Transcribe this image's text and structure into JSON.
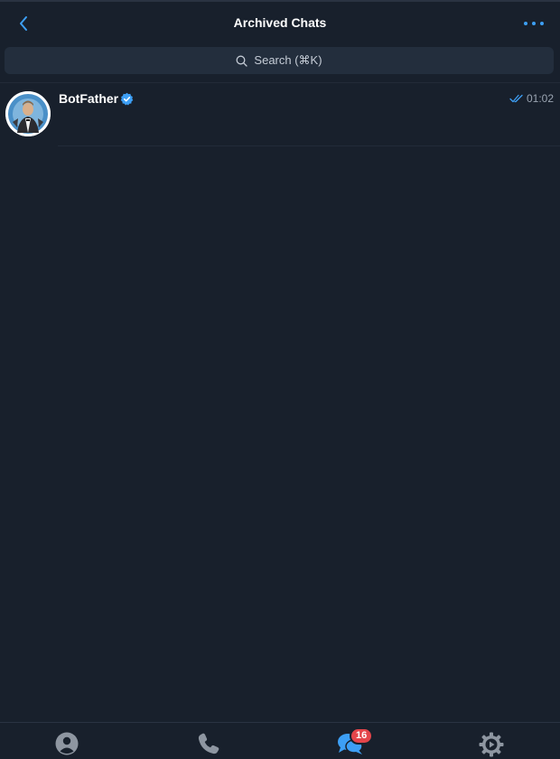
{
  "header": {
    "title": "Archived Chats",
    "back_icon": "chevron-left-icon",
    "more_icon": "ellipsis-icon"
  },
  "search": {
    "placeholder": "Search (⌘K)",
    "icon": "search-icon"
  },
  "chats": [
    {
      "name": "BotFather",
      "verified": true,
      "time": "01:02",
      "status": "read"
    }
  ],
  "tabbar": {
    "tabs": [
      {
        "id": "contacts",
        "icon": "person-icon"
      },
      {
        "id": "calls",
        "icon": "phone-icon"
      },
      {
        "id": "chats",
        "icon": "chat-bubbles-icon",
        "badge": "16",
        "active": true
      },
      {
        "id": "settings",
        "icon": "gear-icon"
      }
    ]
  },
  "colors": {
    "background": "#18202c",
    "accent": "#3d9ff5",
    "badge": "#e4454a",
    "search_bg": "#232e3d",
    "muted_text": "#9aa4b1"
  }
}
